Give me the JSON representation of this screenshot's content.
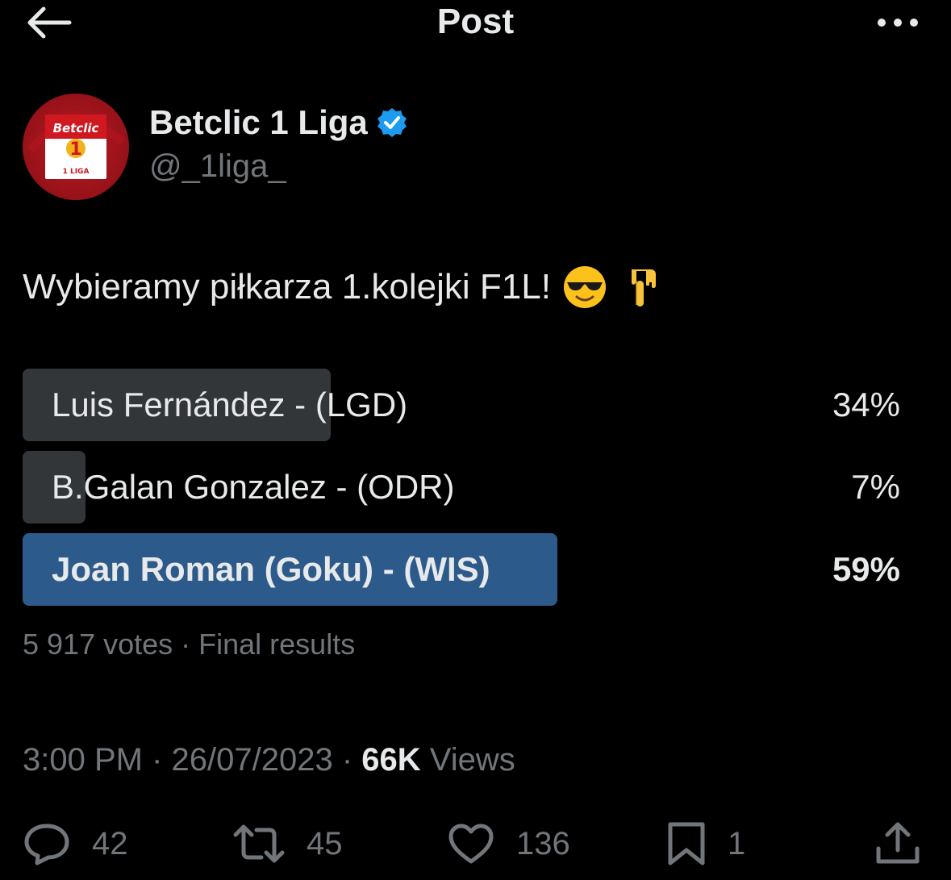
{
  "header": {
    "title": "Post"
  },
  "author": {
    "display_name": "Betclic 1 Liga",
    "handle": "@_1liga_",
    "avatar_text": "Betclic",
    "avatar_sub": "1 LIGA"
  },
  "tweet": {
    "text": "Wybieramy piłkarza 1.kolejki F1L!",
    "emojis": [
      "smiling-face-with-sunglasses",
      "backhand-index-pointing-down"
    ]
  },
  "poll": {
    "options": [
      {
        "label": "Luis Fernández - (LGD)",
        "percent_text": "34%",
        "percent": 34,
        "winner": false
      },
      {
        "label": "B.Galan Gonzalez - (ODR)",
        "percent_text": "7%",
        "percent": 7,
        "winner": false
      },
      {
        "label": "Joan Roman (Goku) - (WIS)",
        "percent_text": "59%",
        "percent": 59,
        "winner": true
      }
    ],
    "meta": "5 917 votes · Final results"
  },
  "timestamp": {
    "time": "3:00 PM",
    "sep1": " · ",
    "date": "26/07/2023",
    "sep2": " · ",
    "views_count": "66K",
    "views_label": " Views"
  },
  "actions": {
    "replies": "42",
    "reposts": "45",
    "likes": "136",
    "bookmarks": "1"
  },
  "colors": {
    "background": "#000000",
    "poll_bar": "#333639",
    "poll_winner": "#2c5a8b",
    "secondary_text": "#71767b",
    "verified": "#1d9bf0",
    "brand_red": "#a8141d"
  }
}
